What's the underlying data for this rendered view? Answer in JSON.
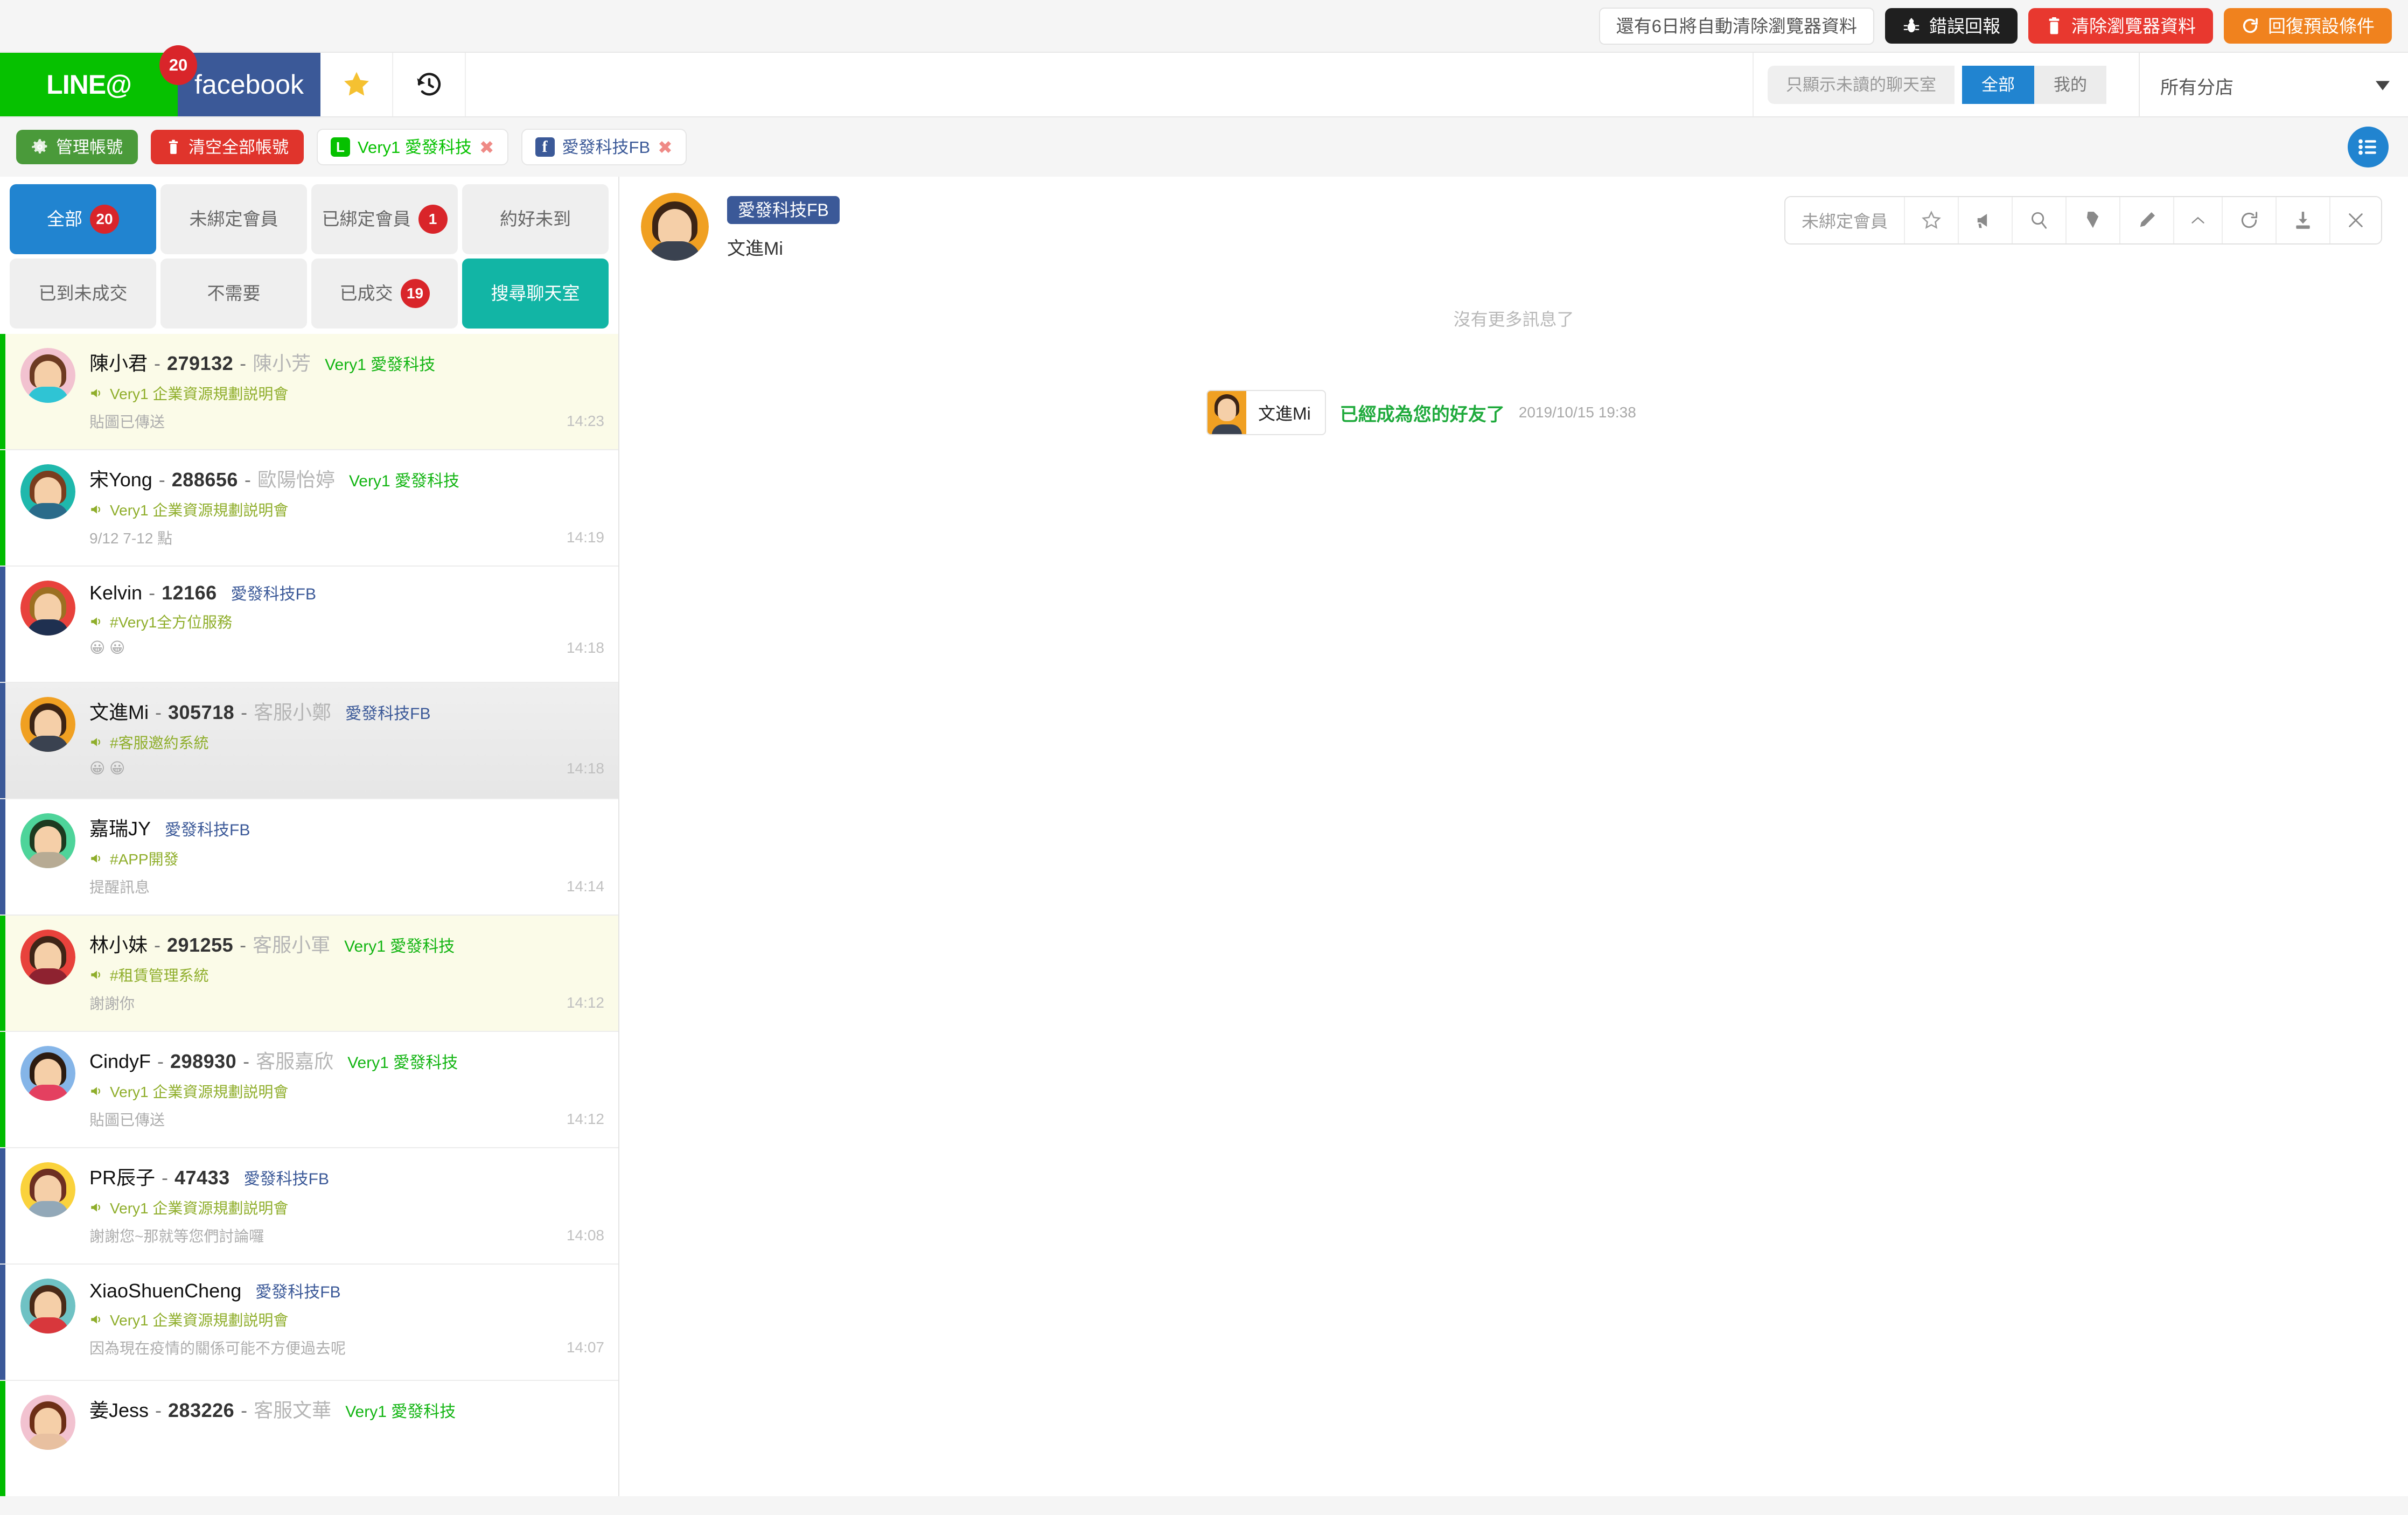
{
  "notice": {
    "message": "還有6日將自動清除瀏覽器資料",
    "bug_report": "錯誤回報",
    "clear_browser_data": "清除瀏覽器資料",
    "restore_defaults": "回復預設條件"
  },
  "header": {
    "brand_line": "LINE@",
    "brand_line_badge": "20",
    "brand_facebook": "facebook",
    "unread_only": "只顯示未讀的聊天室",
    "seg_all": "全部",
    "seg_mine": "我的",
    "branch_selected": "所有分店"
  },
  "account_toolbar": {
    "manage_accounts": "管理帳號",
    "clear_all_accounts": "清空全部帳號",
    "chips": [
      {
        "label": "Very1 愛發科技",
        "type": "line"
      },
      {
        "label": "愛發科技FB",
        "type": "facebook"
      }
    ]
  },
  "filters": [
    {
      "label": "全部",
      "badge": "20",
      "style": "blue"
    },
    {
      "label": "未綁定會員",
      "badge": "",
      "style": "plain"
    },
    {
      "label": "已綁定會員",
      "badge": "1",
      "style": "plain"
    },
    {
      "label": "約好未到",
      "badge": "",
      "style": "plain"
    },
    {
      "label": "已到未成交",
      "badge": "",
      "style": "plain"
    },
    {
      "label": "不需要",
      "badge": "",
      "style": "plain"
    },
    {
      "label": "已成交",
      "badge": "19",
      "style": "plain"
    },
    {
      "label": "搜尋聊天室",
      "badge": "",
      "style": "teal"
    }
  ],
  "chats": [
    {
      "name": "陳小君",
      "id": "279132",
      "staff": "陳小芳",
      "account": "Very1 愛發科技",
      "account_type": "line",
      "tag": "Very1 企業資源規劃説明會",
      "preview": "貼圖已傳送",
      "time": "14:23",
      "unread": true,
      "active": false,
      "avatar": {
        "ring": "#f2c2d0",
        "hair": "#6d3b22",
        "body": "#2fc4d4"
      }
    },
    {
      "name": "宋Yong",
      "id": "288656",
      "staff": "歐陽怡婷",
      "account": "Very1 愛發科技",
      "account_type": "line",
      "tag": "Very1 企業資源規劃説明會",
      "preview": "9/12 7-12 點",
      "time": "14:19",
      "unread": false,
      "active": false,
      "avatar": {
        "ring": "#1fb8ac",
        "hair": "#7a3d1e",
        "body": "#2a6b8a"
      }
    },
    {
      "name": "Kelvin",
      "id": "12166",
      "staff": "",
      "account": "愛發科技FB",
      "account_type": "facebook",
      "tag": "#Very1全方位服務",
      "preview": "😀 😀",
      "time": "14:18",
      "unread": false,
      "active": false,
      "avatar": {
        "ring": "#e8423c",
        "hair": "#9c7022",
        "body": "#1f3050"
      }
    },
    {
      "name": "文進Mi",
      "id": "305718",
      "staff": "客服小鄭",
      "account": "愛發科技FB",
      "account_type": "facebook",
      "tag": "#客服邀約系統",
      "preview": "😀 😀",
      "time": "14:18",
      "unread": false,
      "active": true,
      "avatar": {
        "ring": "#f0a022",
        "hair": "#3c2415",
        "body": "#3a4250"
      }
    },
    {
      "name": "嘉瑞JY",
      "id": "",
      "staff": "",
      "account": "愛發科技FB",
      "account_type": "facebook",
      "tag": "#APP開發",
      "preview": "提醒訊息",
      "time": "14:14",
      "unread": false,
      "active": false,
      "avatar": {
        "ring": "#4ed49a",
        "hair": "#1d3a20",
        "body": "#b7ab94"
      }
    },
    {
      "name": "林小妹",
      "id": "291255",
      "staff": "客服小軍",
      "account": "Very1 愛發科技",
      "account_type": "line",
      "tag": "#租賃管理系統",
      "preview": "謝謝你",
      "time": "14:12",
      "unread": true,
      "active": false,
      "avatar": {
        "ring": "#e8423c",
        "hair": "#3f2517",
        "body": "#8e2230"
      }
    },
    {
      "name": "CindyF",
      "id": "298930",
      "staff": "客服嘉欣",
      "account": "Very1 愛發科技",
      "account_type": "line",
      "tag": "Very1 企業資源規劃説明會",
      "preview": "貼圖已傳送",
      "time": "14:12",
      "unread": false,
      "active": false,
      "avatar": {
        "ring": "#85b5e8",
        "hair": "#2c1b10",
        "body": "#e44060"
      }
    },
    {
      "name": "PR辰子",
      "id": "47433",
      "staff": "",
      "account": "愛發科技FB",
      "account_type": "facebook",
      "tag": "Very1 企業資源規劃説明會",
      "preview": "謝謝您~那就等您們討論囉",
      "time": "14:08",
      "unread": false,
      "active": false,
      "avatar": {
        "ring": "#fad23c",
        "hair": "#6d2f22",
        "body": "#92a8b8"
      }
    },
    {
      "name": "XiaoShuenCheng",
      "id": "",
      "staff": "",
      "account": "愛發科技FB",
      "account_type": "facebook",
      "tag": "Very1 企業資源規劃説明會",
      "preview": "因為現在疫情的關係可能不方便過去呢",
      "time": "14:07",
      "unread": false,
      "active": false,
      "avatar": {
        "ring": "#6fc2c4",
        "hair": "#4a2a18",
        "body": "#d8373c"
      }
    },
    {
      "name": "姜Jess",
      "id": "283226",
      "staff": "客服文華",
      "account": "Very1 愛發科技",
      "account_type": "line",
      "tag": "",
      "preview": "",
      "time": "",
      "unread": false,
      "active": false,
      "avatar": {
        "ring": "#f2c2d0",
        "hair": "#6d2f16",
        "body": "#e8c0a0"
      }
    }
  ],
  "chat_panel": {
    "tag": "愛發科技FB",
    "name": "文進Mi",
    "tools_label": "未綁定會員",
    "tool_icons": [
      "star-icon",
      "megaphone-icon",
      "search-icon",
      "tag-icon",
      "pencil-icon",
      "chevron-up-icon",
      "refresh-icon",
      "download-icon",
      "close-icon"
    ],
    "no_more_messages": "沒有更多訊息了",
    "message": {
      "sender": "文進Mi",
      "text": "已經成為您的好友了",
      "time": "2019/10/15 19:38"
    }
  },
  "colors": {
    "line_green": "#06c100",
    "facebook_blue": "#3b5998",
    "accent_blue": "#2184d0",
    "teal": "#12b5a5",
    "badge_red": "#d9252a",
    "tag_olive": "#8fae2b"
  }
}
